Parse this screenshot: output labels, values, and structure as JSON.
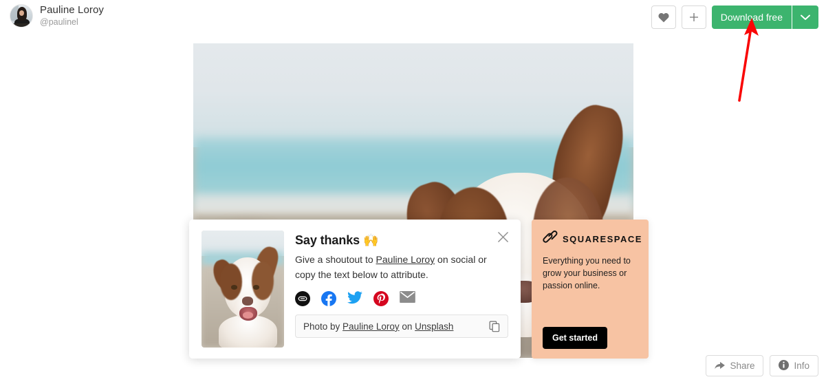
{
  "header": {
    "author_name": "Pauline Loroy",
    "author_handle": "@paulinel",
    "avatar_name": "author-avatar",
    "like_icon": "heart-icon",
    "add_icon": "plus-icon",
    "download_label": "Download free",
    "download_caret_icon": "chevron-down-icon",
    "download_color": "#3cb46e"
  },
  "photo": {
    "alt": "Brown and white Australian Shepherd dog on a beach",
    "name": "main-photo"
  },
  "thanks_modal": {
    "title": "Say thanks 🙌",
    "description_part1": "Give a shoutout to ",
    "description_link": "Pauline Loroy",
    "description_part2": " on social or copy the text below to attribute.",
    "close_icon": "close-icon",
    "thumbnail_name": "photo-thumbnail",
    "social": [
      {
        "name": "link-icon",
        "label": "Copy link",
        "color": "#111111"
      },
      {
        "name": "facebook-icon",
        "label": "Facebook",
        "color": "#1877f2"
      },
      {
        "name": "twitter-icon",
        "label": "Twitter",
        "color": "#1da1f2"
      },
      {
        "name": "pinterest-icon",
        "label": "Pinterest",
        "color": "#d5061f"
      },
      {
        "name": "email-icon",
        "label": "Email",
        "color": "#8c8c8c"
      }
    ],
    "attribution": {
      "prefix": "Photo by ",
      "author": "Pauline Loroy",
      "middle": " on ",
      "source": "Unsplash",
      "copy_icon": "copy-icon"
    }
  },
  "squarespace_ad": {
    "logo_icon": "squarespace-logo-icon",
    "brand": "SQUARESPACE",
    "copy": "Everything you need to grow your business or passion online.",
    "cta_label": "Get started",
    "background_color": "#f7c3a3",
    "cta_background_color": "#000000"
  },
  "corner_actions": {
    "share_label": "Share",
    "share_icon": "share-arrow-icon",
    "info_label": "Info",
    "info_icon": "info-circle-icon"
  },
  "annotation": {
    "arrow_name": "red-pointer-arrow",
    "arrow_color": "#f90505",
    "points_to": "Download free"
  }
}
